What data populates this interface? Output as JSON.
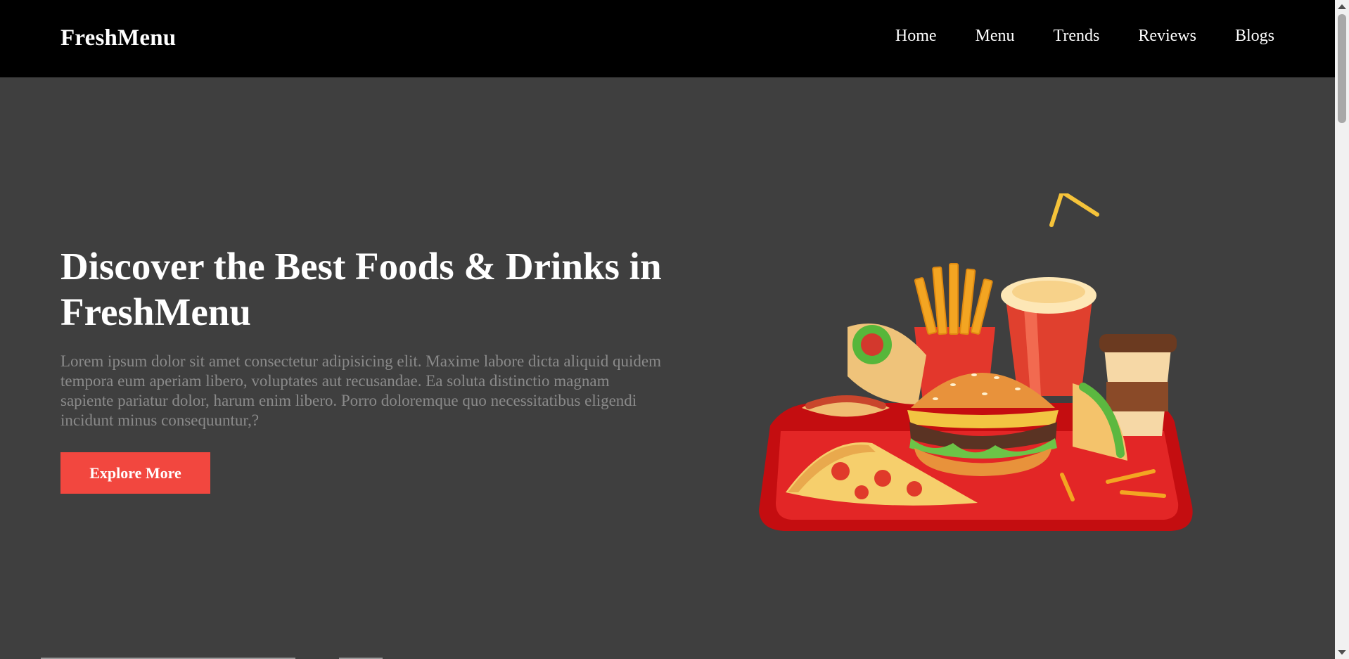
{
  "navbar": {
    "brand": "FreshMenu",
    "links": [
      "Home",
      "Menu",
      "Trends",
      "Reviews",
      "Blogs"
    ]
  },
  "hero": {
    "title": "Discover the Best Foods & Drinks in FreshMenu",
    "description": "Lorem ipsum dolor sit amet consectetur adipisicing elit. Maxime labore dicta aliquid quidem tempora eum aperiam libero, voluptates aut recusandae. Ea soluta distinctio magnam sapiente pariatur dolor, harum enim libero. Porro doloremque quo necessitatibus eligendi incidunt minus consequuntur,?",
    "button_label": "Explore More",
    "image": "fast-food-tray-illustration"
  },
  "colors": {
    "navbar_bg": "#000000",
    "page_bg": "#3f3f3f",
    "accent": "#f2473f",
    "body_text": "#8a8a8a"
  }
}
